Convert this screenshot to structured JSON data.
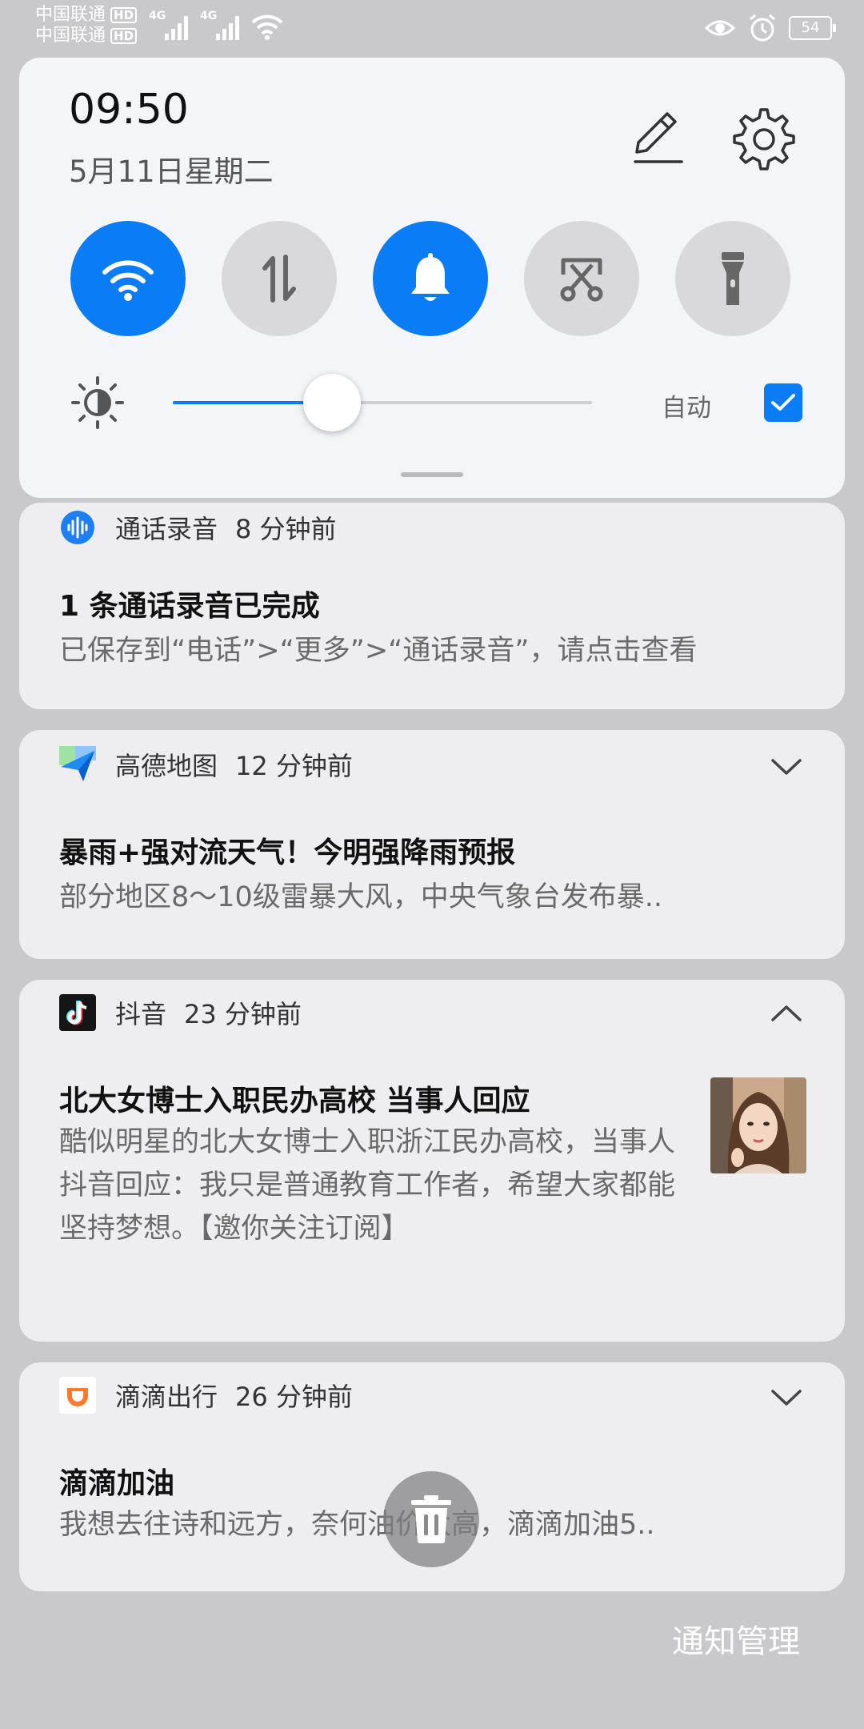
{
  "status_bar": {
    "carrier_1": "中国联通",
    "carrier_2": "中国联通",
    "hd_1": "HD",
    "hd_2": "HD",
    "net_1": "4G",
    "net_2": "4G",
    "battery": "54",
    "icons": [
      "eye-comfort-icon",
      "alarm-icon",
      "battery-icon",
      "wifi-icon",
      "signal-icon"
    ]
  },
  "quick_settings": {
    "time": "09:50",
    "date": "5月11日星期二",
    "tiles": [
      {
        "name": "wifi",
        "state": "on"
      },
      {
        "name": "mobile-data",
        "state": "off"
      },
      {
        "name": "sound",
        "state": "on"
      },
      {
        "name": "screenshot",
        "state": "off"
      },
      {
        "name": "flashlight",
        "state": "off"
      }
    ],
    "brightness_level": 0.38,
    "auto_label": "自动",
    "auto_checked": true,
    "accent": "#0a7cf6"
  },
  "notifications": [
    {
      "app": "通话录音",
      "time": "8 分钟前",
      "title": "1 条通话录音已完成",
      "body": "已保存到“电话”>“更多”>“通话录音”，请点击查看"
    },
    {
      "app": "高德地图",
      "time": "12 分钟前",
      "title": "暴雨+强对流天气！今明强降雨预报",
      "body": "部分地区8～10级雷暴大风，中央气象台发布暴.."
    },
    {
      "app": "抖音",
      "time": "23 分钟前",
      "title": "北大女博士入职民办高校 当事人回应",
      "body": "酷似明星的北大女博士入职浙江民办高校，当事人抖音回应：我只是普通教育工作者，希望大家都能坚持梦想。【邀你关注订阅】"
    },
    {
      "app": "滴滴出行",
      "time": "26 分钟前",
      "title": "滴滴加油",
      "body": "我想去往诗和远方，奈何油价太高，滴滴加油5.."
    }
  ],
  "footer": {
    "manage_label": "通知管理"
  }
}
